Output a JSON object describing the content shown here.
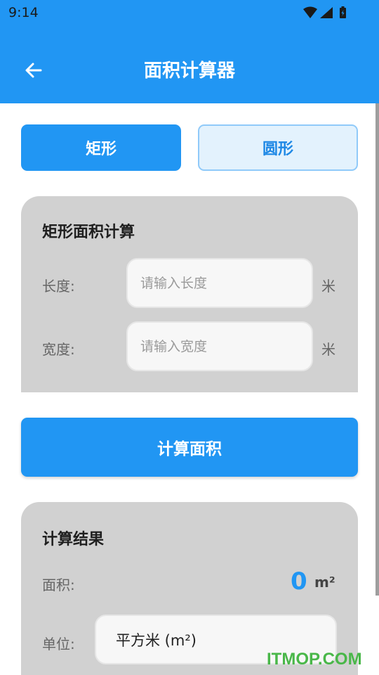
{
  "status_bar": {
    "time": "9:14"
  },
  "app_bar": {
    "title": "面积计算器"
  },
  "tabs": [
    {
      "label": "矩形",
      "active": true
    },
    {
      "label": "圆形",
      "active": false
    }
  ],
  "input_card": {
    "title": "矩形面积计算",
    "fields": [
      {
        "label": "长度:",
        "placeholder": "请输入长度",
        "value": "",
        "unit": "米"
      },
      {
        "label": "宽度:",
        "placeholder": "请输入宽度",
        "value": "",
        "unit": "米"
      }
    ]
  },
  "calculate_button": {
    "label": "计算面积"
  },
  "result_card": {
    "title": "计算结果",
    "area_label": "面积:",
    "area_value": "0",
    "area_unit": "m²",
    "unit_label": "单位:",
    "unit_selected": "平方米 (m²)"
  },
  "watermark": "ITMOP.COM",
  "colors": {
    "primary": "#2196f3",
    "card_bg": "#d1d1d1",
    "tab_inactive_bg": "#e3f2fd",
    "watermark": "#49b749"
  }
}
